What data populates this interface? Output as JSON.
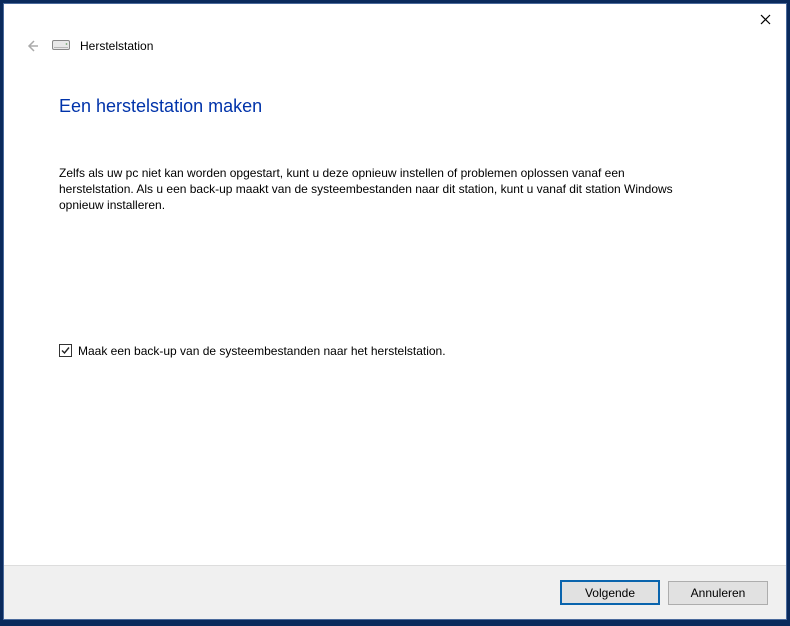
{
  "window": {
    "title": "Herstelstation"
  },
  "content": {
    "heading": "Een herstelstation maken",
    "description": "Zelfs als uw pc niet kan worden opgestart, kunt u deze opnieuw instellen of problemen oplossen vanaf een herstelstation. Als u een back-up maakt van de systeembestanden naar dit station, kunt u vanaf dit station Windows opnieuw installeren.",
    "checkbox_label": "Maak een back-up van de systeembestanden naar het herstelstation.",
    "checkbox_checked": true
  },
  "footer": {
    "next_label": "Volgende",
    "cancel_label": "Annuleren"
  }
}
